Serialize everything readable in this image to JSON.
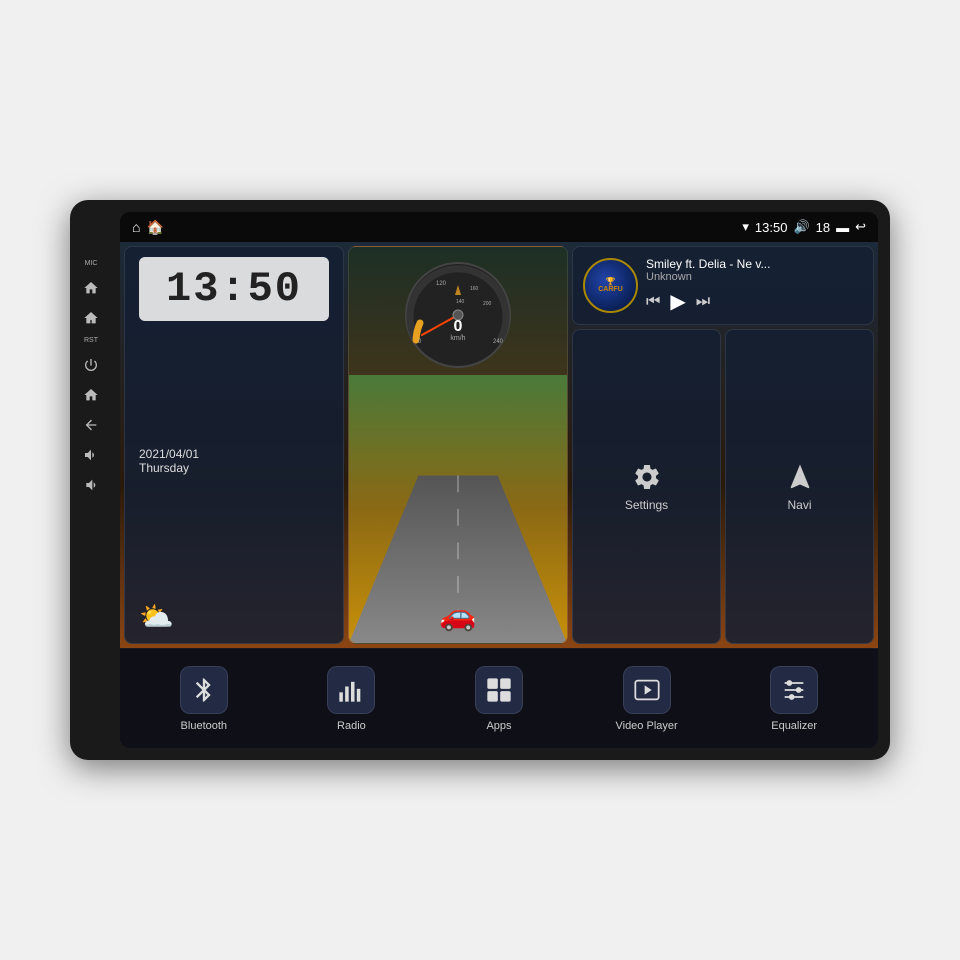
{
  "device": {
    "labels": {
      "mic": "MIC",
      "rst": "RST"
    }
  },
  "status_bar": {
    "left_icon_home": "⌂",
    "left_icon_home2": "🏠",
    "time": "13:50",
    "volume": "18",
    "wifi_icon": "▼",
    "battery_icon": "▬",
    "back_icon": "↩"
  },
  "clock": {
    "time": "13:50",
    "date": "2021/04/01",
    "day": "Thursday",
    "weather_icon": "⛅"
  },
  "speedometer": {
    "speed": "0",
    "unit": "km/h",
    "min": "0",
    "max": "240"
  },
  "music": {
    "title": "Smiley ft. Delia - Ne v...",
    "artist": "Unknown",
    "logo_text": "CARFU"
  },
  "buttons": {
    "settings": "Settings",
    "navi": "Navi"
  },
  "bottom_bar": [
    {
      "id": "bluetooth",
      "label": "Bluetooth"
    },
    {
      "id": "radio",
      "label": "Radio"
    },
    {
      "id": "apps",
      "label": "Apps"
    },
    {
      "id": "video-player",
      "label": "Video Player"
    },
    {
      "id": "equalizer",
      "label": "Equalizer"
    }
  ]
}
